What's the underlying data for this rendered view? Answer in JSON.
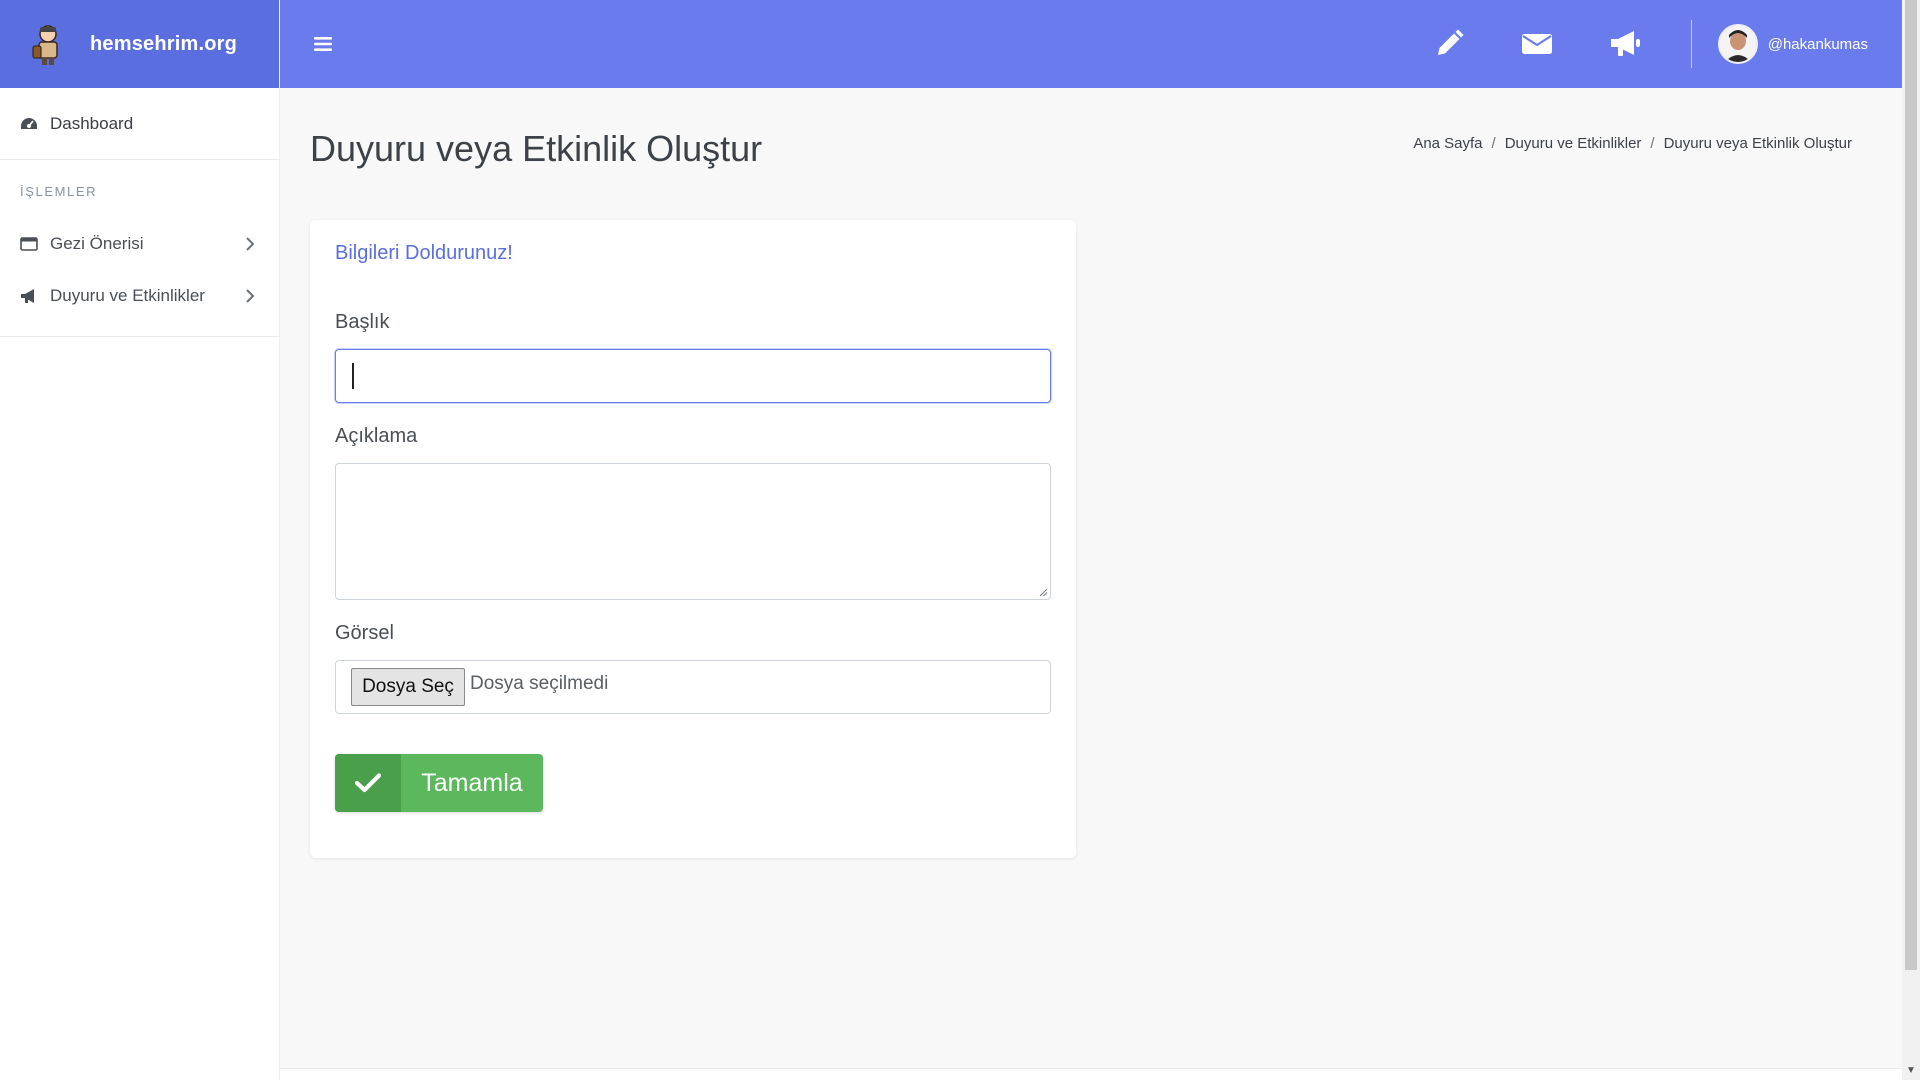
{
  "brand": {
    "name": "hemsehrim.org"
  },
  "sidebar": {
    "dashboard": "Dashboard",
    "heading": "İŞLEMLER",
    "items": [
      {
        "label": "Gezi Önerisi",
        "icon": "window-icon"
      },
      {
        "label": "Duyuru ve Etkinlikler",
        "icon": "bullhorn-icon"
      }
    ]
  },
  "topbar": {
    "icons": [
      "pencil-icon",
      "envelope-icon",
      "bullhorn-icon"
    ],
    "username": "@hakankumas"
  },
  "page": {
    "title": "Duyuru veya Etkinlik Oluştur",
    "breadcrumb": [
      "Ana Sayfa",
      "Duyuru ve Etkinlikler",
      "Duyuru veya Etkinlik Oluştur"
    ]
  },
  "form": {
    "card_title": "Bilgileri Doldurunuz!",
    "title_label": "Başlık",
    "title_value": "",
    "desc_label": "Açıklama",
    "desc_value": "",
    "image_label": "Görsel",
    "file_button": "Dosya Seç",
    "file_status": "Dosya seçilmedi",
    "submit_label": "Tamamla"
  },
  "colors": {
    "accent": "#6a7ced",
    "brand_bg": "#5a6ee0",
    "success": "#5cb85c"
  }
}
